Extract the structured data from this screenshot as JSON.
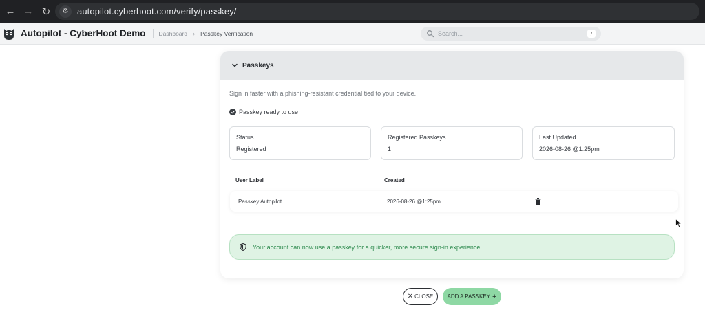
{
  "browser": {
    "url": "autopilot.cyberhoot.com/verify/passkey/",
    "back_icon": "arrow-left-icon",
    "forward_icon": "arrow-right-icon",
    "reload_icon": "reload-icon"
  },
  "header": {
    "app_title": "Autopilot - CyberHoot Demo",
    "breadcrumb": [
      "Dashboard",
      "Passkey Verification"
    ],
    "search_placeholder": "Search...",
    "search_shortcut": "/"
  },
  "card": {
    "title": "Passkeys",
    "subtitle": "Sign in faster with a phishing-resistant credential tied to your device.",
    "status_message": "Passkey ready to use",
    "stats": [
      {
        "label": "Status",
        "value": "Registered"
      },
      {
        "label": "Registered Passkeys",
        "value": "1"
      },
      {
        "label": "Last Updated",
        "value": "2026-08-26 @1:25pm"
      }
    ],
    "table": {
      "columns": [
        "User Label",
        "Created"
      ],
      "rows": [
        {
          "label": "Passkey Autopilot",
          "created": "2026-08-26 @1:25pm"
        }
      ]
    },
    "alert_text": "Your account can now use a passkey for a quicker, more secure sign-in experience."
  },
  "actions": {
    "close_label": "CLOSE",
    "close_icon_glyph": "✕",
    "add_label": "ADD A PASSKEY",
    "add_icon_glyph": "+"
  },
  "colors": {
    "accent_green": "#8ed8a4",
    "alert_bg": "#dff3e4",
    "alert_text": "#2f8b4f",
    "browser_bar": "#202124"
  }
}
